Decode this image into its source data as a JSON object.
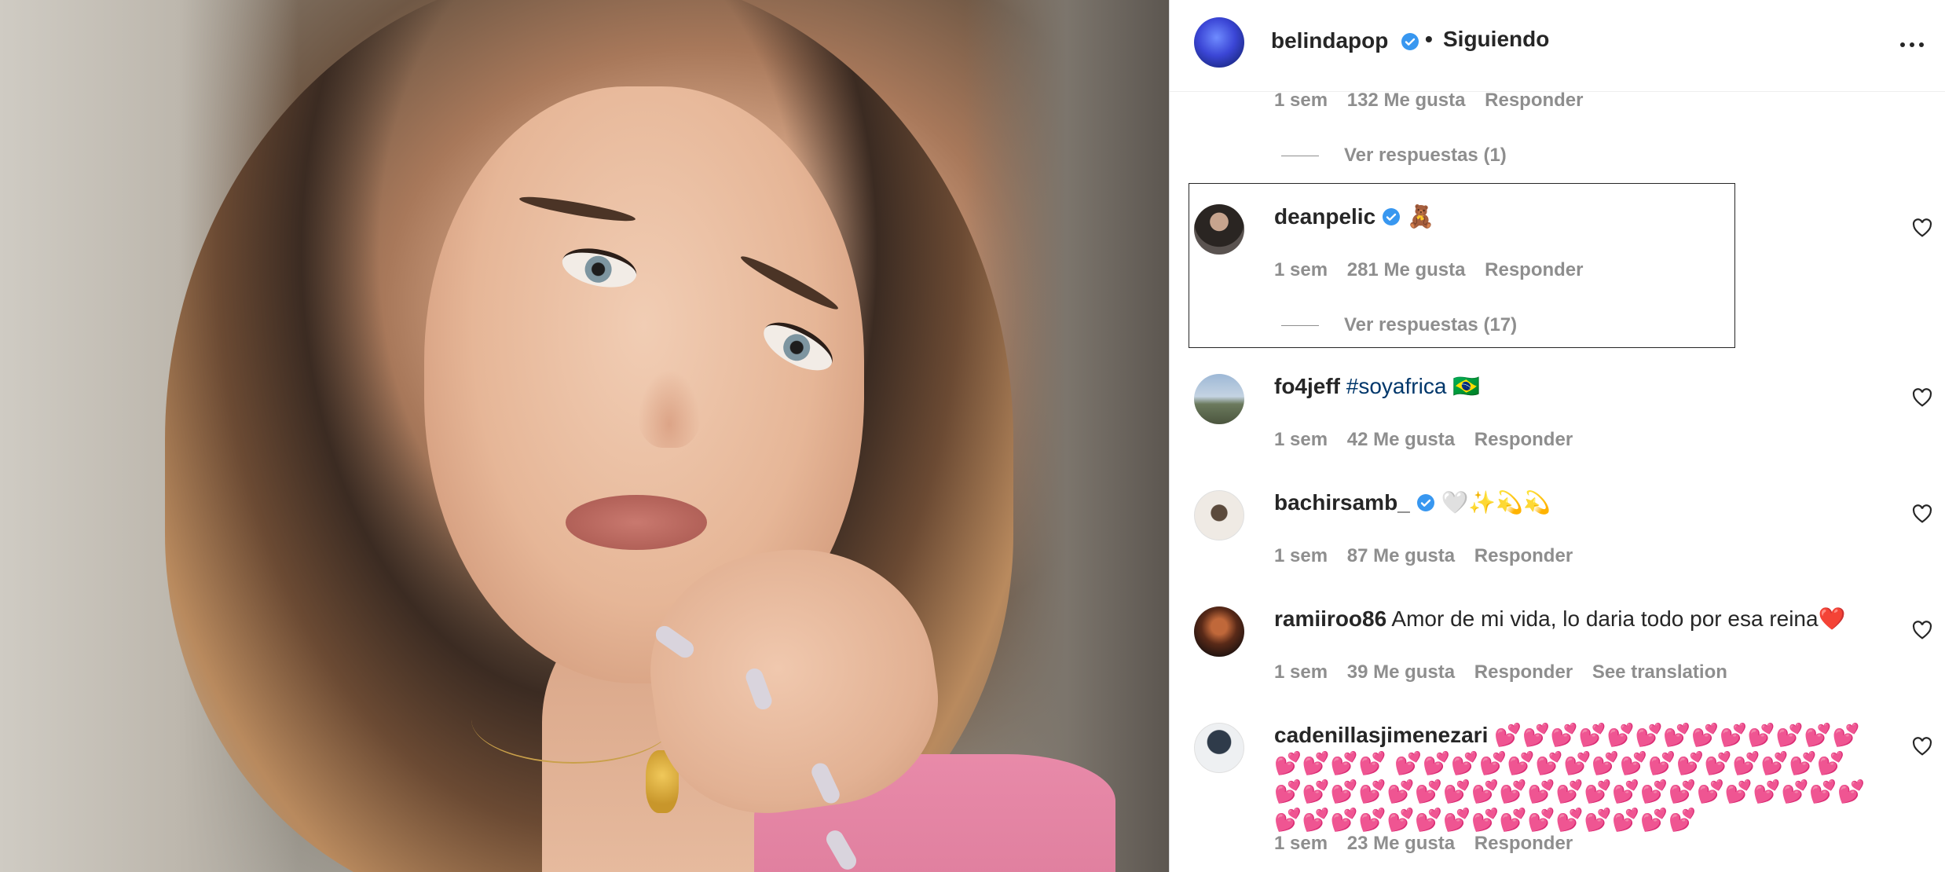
{
  "post": {
    "image_alt": "belindapop post photo"
  },
  "header": {
    "username": "belindapop",
    "separator": "•",
    "follow_status": "Siguiendo",
    "more_icon": "more-horizontal-icon"
  },
  "prev_comment": {
    "time": "1 sem",
    "likes": "132 Me gusta",
    "reply": "Responder",
    "view_replies": "Ver respuestas (1)"
  },
  "comments": [
    {
      "username": "deanpelic",
      "verified": true,
      "text": "🧸",
      "time": "1 sem",
      "likes": "281 Me gusta",
      "reply": "Responder",
      "view_replies": "Ver respuestas (17)"
    },
    {
      "username": "fo4jeff",
      "verified": false,
      "hashtag": "#soyafrica",
      "text": "🇧🇷",
      "time": "1 sem",
      "likes": "42 Me gusta",
      "reply": "Responder"
    },
    {
      "username": "bachirsamb_",
      "verified": true,
      "text": "🤍✨💫💫",
      "time": "1 sem",
      "likes": "87 Me gusta",
      "reply": "Responder"
    },
    {
      "username": "ramiiroo86",
      "verified": false,
      "text": "Amor de mi vida, lo daria todo por esa reina❤️",
      "time": "1 sem",
      "likes": "39 Me gusta",
      "reply": "Responder",
      "translate": "See translation"
    },
    {
      "username": "cadenillasjimenezari",
      "verified": false,
      "text": "💕💕💕💕💕💕💕💕💕💕💕💕💕💕💕💕💕 💕💕💕💕💕💕💕💕💕💕💕💕💕💕💕💕💕💕💕💕💕💕💕💕💕💕💕💕💕💕💕💕💕💕💕💕💕💕💕💕💕💕💕💕💕💕💕💕💕💕💕💕",
      "time": "1 sem",
      "likes": "23 Me gusta",
      "reply": "Responder"
    }
  ],
  "colors": {
    "text": "#262626",
    "secondary": "#8e8e8e",
    "verified": "#3897f0",
    "hashtag": "#00376b",
    "border": "#dbdbdb"
  }
}
